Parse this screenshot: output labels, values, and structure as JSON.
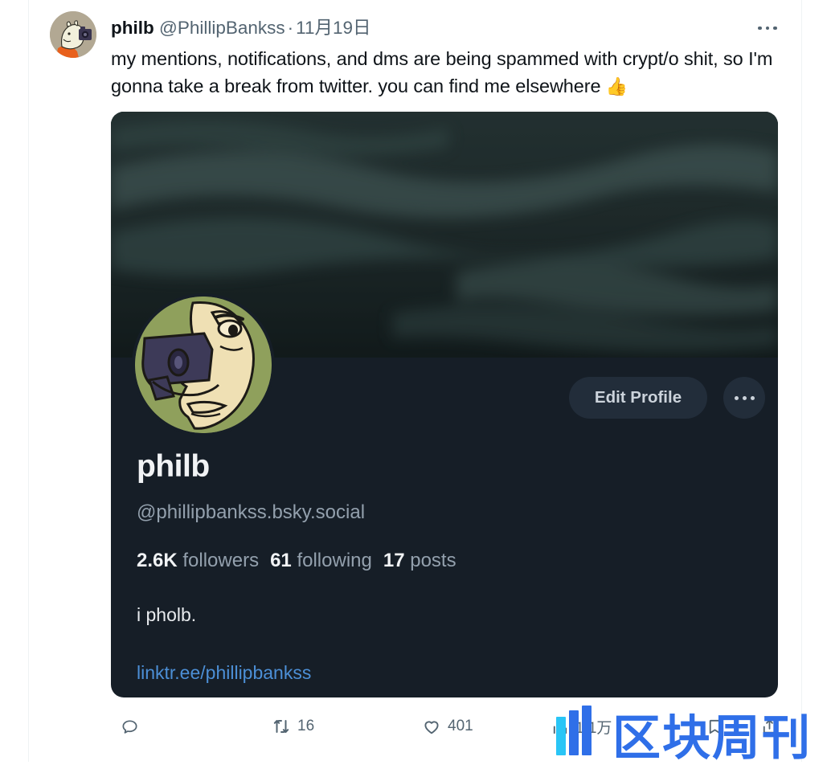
{
  "tweet": {
    "display_name": "philb",
    "handle": "@PhillipBankss",
    "separator": "·",
    "date": "11月19日",
    "body": "my mentions, notifications, and dms are being spammed with crypt/o shit, so I'm gonna take a break from twitter. you can find me elsewhere ",
    "body_emoji": "👍",
    "more_menu_label": "More"
  },
  "embed": {
    "name": "philb",
    "handle": "@phillipbankss.bsky.social",
    "followers_count": "2.6K",
    "followers_label": "followers",
    "following_count": "61",
    "following_label": "following",
    "posts_count": "17",
    "posts_label": "posts",
    "bio": "i pholb.",
    "link": "linktr.ee/phillipbankss",
    "edit_profile_label": "Edit Profile",
    "more_label": "More options"
  },
  "actions": {
    "reply_count": "",
    "retweet_count": "16",
    "like_count": "401",
    "views_count": "1.1万",
    "bookmark_count": "",
    "share_count": ""
  },
  "watermark": {
    "text": "区块周刊"
  },
  "colors": {
    "text_primary": "#0f1419",
    "text_secondary": "#536471",
    "card_background": "#161e27",
    "banner": "#1b2a2a",
    "avatar_green": "#8fa05c",
    "link_blue": "#4c8fd6",
    "watermark_blue": "#2f6fe8",
    "watermark_cyan": "#29c5f6",
    "button_fill": "#222d3a"
  }
}
